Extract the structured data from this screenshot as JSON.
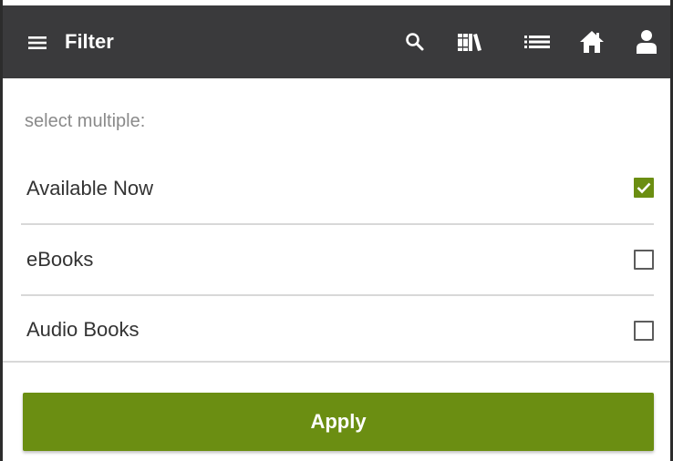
{
  "header": {
    "title": "Filter",
    "icons": [
      "menu-icon",
      "search-icon",
      "library-icon",
      "list-icon",
      "home-icon",
      "person-icon"
    ]
  },
  "filter": {
    "hint": "select multiple:",
    "options": [
      {
        "label": "Available Now",
        "checked": true
      },
      {
        "label": "eBooks",
        "checked": false
      },
      {
        "label": "Audio Books",
        "checked": false
      }
    ],
    "apply_label": "Apply"
  },
  "colors": {
    "app_bar": "#3a3a3c",
    "accent": "#6b8e12",
    "divider": "#d8d8d8"
  }
}
